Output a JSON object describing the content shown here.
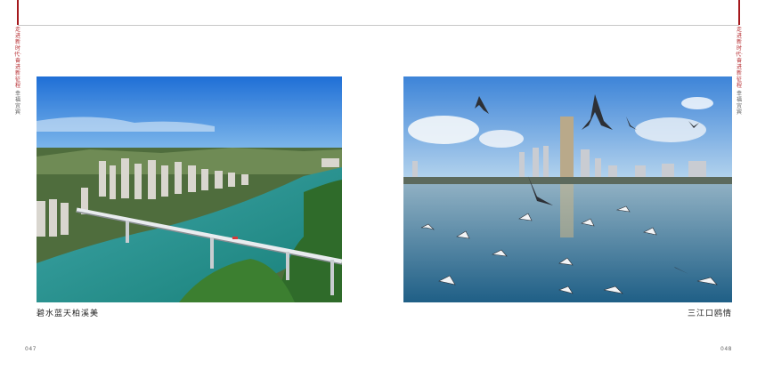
{
  "left_page": {
    "side_tag_red": "走进新时代·奋进新征程",
    "side_tag_dark": "幸福宜宾",
    "caption": "碧水蓝天柏溪美",
    "page_number": "047"
  },
  "right_page": {
    "side_tag_red": "走进新时代·奋进新征程",
    "side_tag_dark": "幸福宜宾",
    "caption": "三江口鸥情",
    "page_number": "048"
  },
  "colors": {
    "accent_red": "#a4181c",
    "rule_gray": "#c8c8c8"
  }
}
